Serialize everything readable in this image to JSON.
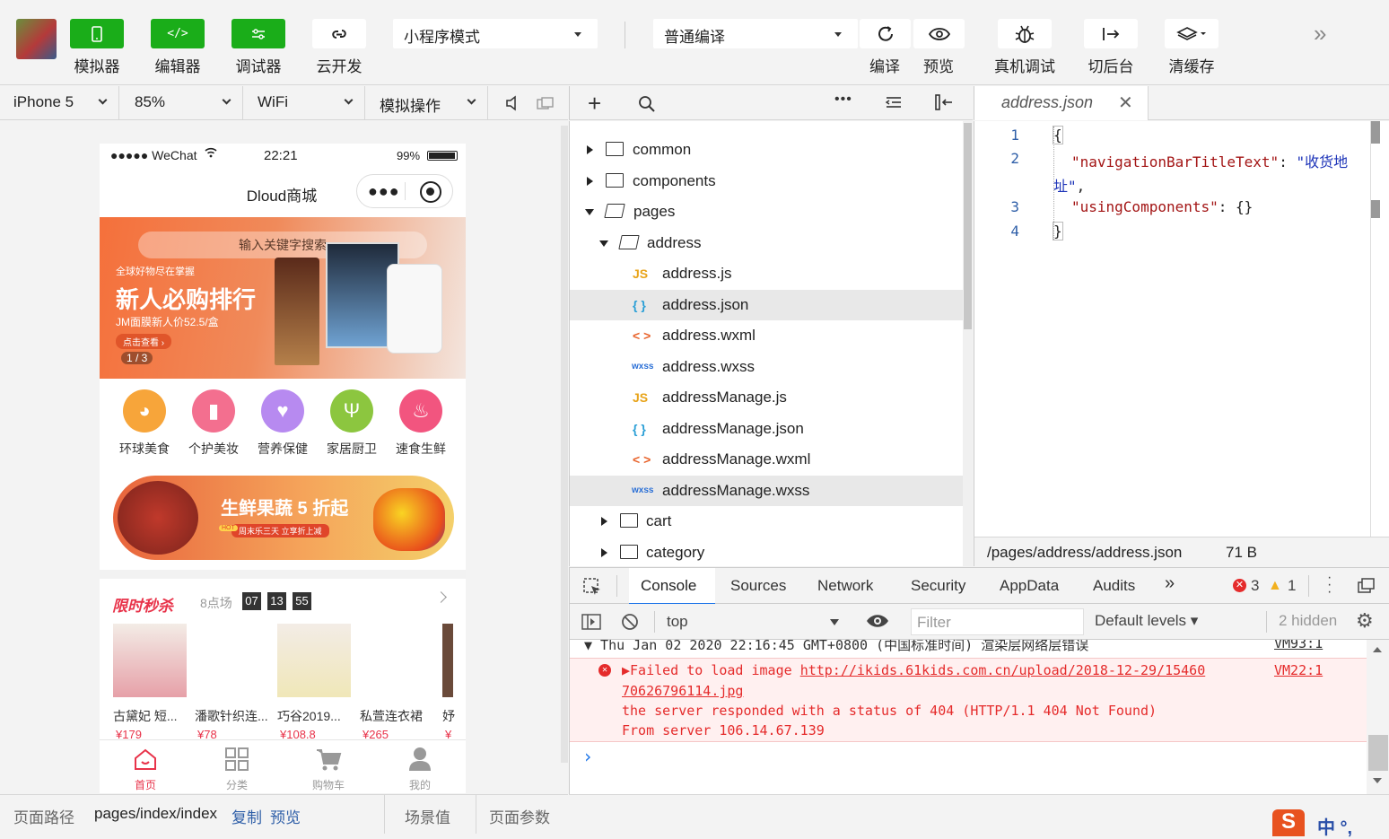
{
  "toolbar": {
    "simulator_label": "模拟器",
    "editor_label": "编辑器",
    "debugger_label": "调试器",
    "cloud_label": "云开发",
    "mode_select": "小程序模式",
    "compile_select": "普通编译",
    "compile_label": "编译",
    "preview_label": "预览",
    "device_debug_label": "真机调试",
    "backstage_label": "切后台",
    "clear_cache_label": "清缓存",
    "more_icon": "»"
  },
  "simbar": {
    "device": "iPhone 5",
    "zoom": "85%",
    "network": "WiFi",
    "simulate_op": "模拟操作"
  },
  "phone": {
    "status_signal": "●●●●● WeChat",
    "status_time": "22:21",
    "status_battery": "99%",
    "nav_title": "Dloud商城",
    "search_placeholder": "输入关键字搜索",
    "banner_small": "全球好物尽在掌握",
    "banner_title": "新人必购排行",
    "banner_sub": "JM面膜新人价52.5/盒",
    "banner_btn": "点击查看 ›",
    "banner_page": "1 / 3",
    "categories": [
      {
        "label": "环球美食",
        "color": "#f7a53a"
      },
      {
        "label": "个护美妆",
        "color": "#f36f8f"
      },
      {
        "label": "营养保健",
        "color": "#b78af0"
      },
      {
        "label": "家居厨卫",
        "color": "#8cc63f"
      },
      {
        "label": "速食生鲜",
        "color": "#f2557f"
      }
    ],
    "fresh_banner_title": "生鲜果蔬 5 折起",
    "fresh_banner_sub": "周末乐三天 立享折上减",
    "fresh_banner_hot": "HOT",
    "flash_title": "限时秒杀",
    "flash_session": "8点场",
    "flash_h": "07",
    "flash_m": "13",
    "flash_s": "55",
    "products": [
      {
        "name": "古黛妃 短...",
        "price": "¥179"
      },
      {
        "name": "潘歌针织连...",
        "price": "¥78"
      },
      {
        "name": "巧谷2019...",
        "price": "¥108.8"
      },
      {
        "name": "私萱连衣裙",
        "price": "¥265"
      },
      {
        "name": "妤",
        "price": "¥"
      }
    ],
    "tabs": [
      "首页",
      "分类",
      "购物车",
      "我的"
    ]
  },
  "pathbar": {
    "label": "页面路径",
    "path": "pages/index/index",
    "copy": "复制",
    "preview": "预览",
    "scene": "场景值",
    "params": "页面参数"
  },
  "tree": {
    "items": [
      {
        "name": "common",
        "type": "folder"
      },
      {
        "name": "components",
        "type": "folder"
      },
      {
        "name": "pages",
        "type": "folder-open"
      },
      {
        "name": "address",
        "type": "folder-open"
      },
      {
        "name": "address.js",
        "type": "js"
      },
      {
        "name": "address.json",
        "type": "json"
      },
      {
        "name": "address.wxml",
        "type": "wxml"
      },
      {
        "name": "address.wxss",
        "type": "wxss"
      },
      {
        "name": "addressManage.js",
        "type": "js"
      },
      {
        "name": "addressManage.json",
        "type": "json"
      },
      {
        "name": "addressManage.wxml",
        "type": "wxml"
      },
      {
        "name": "addressManage.wxss",
        "type": "wxss"
      },
      {
        "name": "cart",
        "type": "folder"
      },
      {
        "name": "category",
        "type": "folder"
      }
    ],
    "icon_js": "JS",
    "icon_json": "{ }",
    "icon_wxml": "< >",
    "icon_wxss": "wxss"
  },
  "editor": {
    "tab_title": "address.json",
    "lines": [
      "1",
      "2",
      "3",
      "4"
    ],
    "code_l1": "{",
    "code_key1": "\"navigationBarTitleText\"",
    "code_colon1": ": ",
    "code_val1": "\"收货地",
    "code_val1b": "址\"",
    "code_comma": ",",
    "code_key2": "\"usingComponents\"",
    "code_colon2": ": {}",
    "code_l4": "}",
    "status_path": "/pages/address/address.json",
    "status_size": "71 B"
  },
  "devtools": {
    "tabs": [
      "Console",
      "Sources",
      "Network",
      "Security",
      "AppData",
      "Audits"
    ],
    "errors": "3",
    "warnings": "1",
    "context": "top",
    "filter_placeholder": "Filter",
    "levels": "Default levels ▾",
    "hidden": "2 hidden",
    "log_header": "▼ Thu Jan 02 2020 22:16:45 GMT+0800 (中国标准时间) 渲染层网络层错误",
    "log_header_src": "VM93:1",
    "err_line1": "▶Failed to load image ",
    "err_link1": "http://ikids.61kids.com.cn/upload/2018-12-29/15460",
    "err_src": "VM22:1",
    "err_link2": "70626796114.jpg",
    "err_line3": "the server responded with a status of 404 (HTTP/1.1 404 Not Found)",
    "err_line4": "From server 106.14.67.139",
    "prompt": "›"
  },
  "ime": {
    "logo": "S",
    "text": "中 °,"
  }
}
